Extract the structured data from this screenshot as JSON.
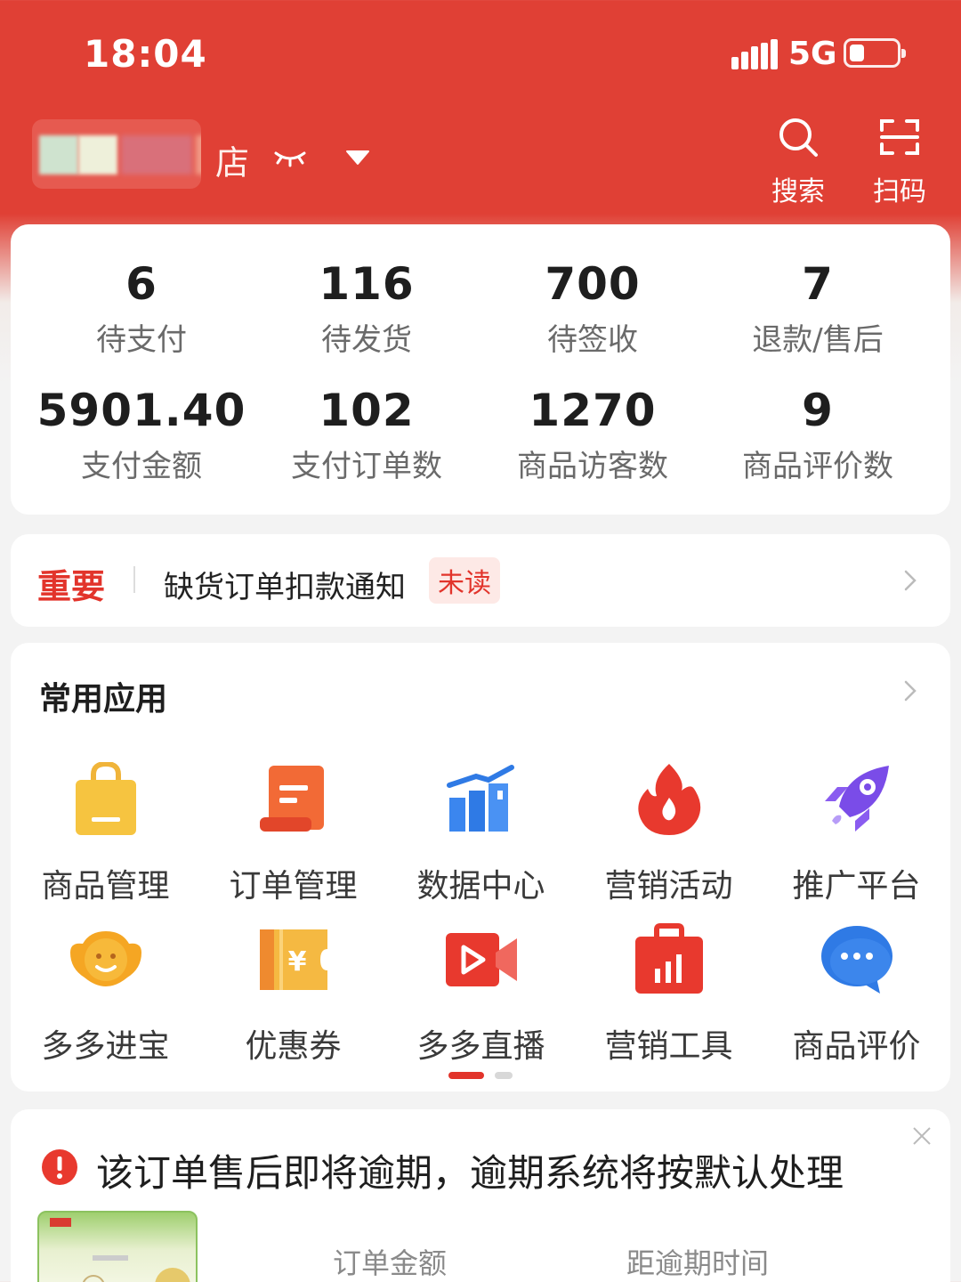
{
  "status_bar": {
    "time": "18:04",
    "network": "5G",
    "battery_level": 0.3
  },
  "header": {
    "store_name_suffix": "店",
    "search_label": "搜索",
    "scan_label": "扫码"
  },
  "stats": [
    {
      "value": "6",
      "label": "待支付"
    },
    {
      "value": "116",
      "label": "待发货"
    },
    {
      "value": "700",
      "label": "待签收"
    },
    {
      "value": "7",
      "label": "退款/售后"
    },
    {
      "value": "5901.40",
      "label": "支付金额"
    },
    {
      "value": "102",
      "label": "支付订单数"
    },
    {
      "value": "1270",
      "label": "商品访客数"
    },
    {
      "value": "9",
      "label": "商品评价数"
    }
  ],
  "notice": {
    "tag": "重要",
    "text": "缺货订单扣款通知",
    "badge": "未读"
  },
  "apps": {
    "title": "常用应用",
    "items": [
      {
        "label": "商品管理",
        "icon": "shopping-bag-icon"
      },
      {
        "label": "订单管理",
        "icon": "order-scroll-icon"
      },
      {
        "label": "数据中心",
        "icon": "bar-chart-icon"
      },
      {
        "label": "营销活动",
        "icon": "flame-icon"
      },
      {
        "label": "推广平台",
        "icon": "rocket-icon"
      },
      {
        "label": "多多进宝",
        "icon": "treasure-icon"
      },
      {
        "label": "优惠券",
        "icon": "coupon-icon"
      },
      {
        "label": "多多直播",
        "icon": "live-video-icon"
      },
      {
        "label": "营销工具",
        "icon": "toolbox-icon"
      },
      {
        "label": "商品评价",
        "icon": "chat-bubble-icon"
      }
    ],
    "page_indicator": {
      "current": 1,
      "total": 2
    }
  },
  "alert": {
    "text": "该订单售后即将逾期，逾期系统将按默认处理",
    "col1": "订单金额",
    "col2": "距逾期时间"
  },
  "colors": {
    "brand_red": "#e04035",
    "alert_red": "#e2342b",
    "background": "#f3f3f3"
  }
}
